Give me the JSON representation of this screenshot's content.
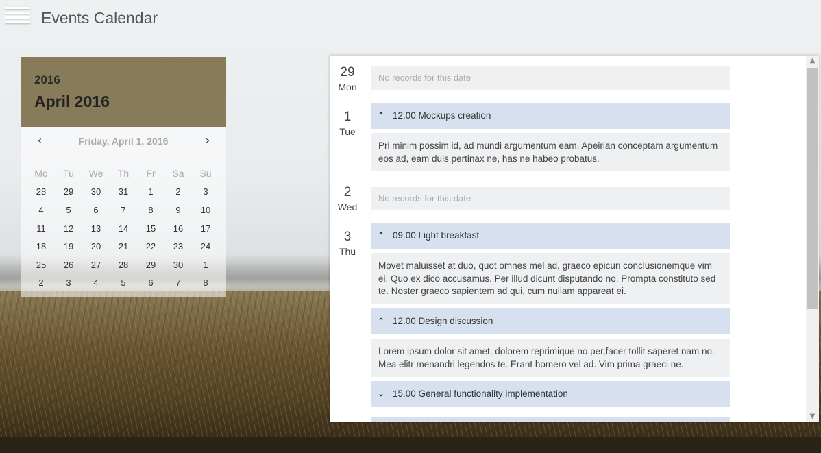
{
  "header": {
    "title": "Events Calendar",
    "menu_icon": "hamburger-menu-icon"
  },
  "calendar": {
    "year": "2016",
    "month_title": "April 2016",
    "selected_label": "Friday, April 1, 2016",
    "prev_icon": "‹",
    "next_icon": "›",
    "weekdays": [
      "Mo",
      "Tu",
      "We",
      "Th",
      "Fr",
      "Sa",
      "Su"
    ],
    "weeks": [
      [
        "28",
        "29",
        "30",
        "31",
        "1",
        "2",
        "3"
      ],
      [
        "4",
        "5",
        "6",
        "7",
        "8",
        "9",
        "10"
      ],
      [
        "11",
        "12",
        "13",
        "14",
        "15",
        "16",
        "17"
      ],
      [
        "18",
        "19",
        "20",
        "21",
        "22",
        "23",
        "24"
      ],
      [
        "25",
        "26",
        "27",
        "28",
        "29",
        "30",
        "1"
      ],
      [
        "2",
        "3",
        "4",
        "5",
        "6",
        "7",
        "8"
      ]
    ]
  },
  "events": {
    "no_records_text": "No records for this date",
    "days": [
      {
        "num": "29",
        "name": "Mon"
      },
      {
        "num": "1",
        "name": "Tue"
      },
      {
        "num": "2",
        "name": "Wed"
      },
      {
        "num": "3",
        "name": "Thu"
      }
    ],
    "items": [
      {
        "title": "12.00 Mockups creation",
        "expanded": true,
        "chevron": "^",
        "desc": "Pri minim possim id, ad mundi argumentum eam. Apeirian conceptam argumentum eos ad, eam duis pertinax ne, has ne habeo probatus."
      },
      {
        "title": "09.00 Light breakfast",
        "expanded": true,
        "chevron": "^",
        "desc": "Movet maluisset at duo, quot omnes mel ad, graeco epicuri conclusionemque vim ei. Quo ex dico accusamus. Per illud dicunt disputando no. Prompta constituto sed te. Noster graeco sapientem ad qui, cum nullam appareat ei."
      },
      {
        "title": "12.00 Design discussion",
        "expanded": true,
        "chevron": "^",
        "desc": "Lorem ipsum dolor sit amet, dolorem reprimique no per,facer tollit saperet nam no. Mea elitr menandri legendos te. Erant homero vel ad. Vim prima graeci ne."
      },
      {
        "title": "15.00 General functionality implementation",
        "expanded": false,
        "chevron": "v"
      }
    ]
  },
  "colors": {
    "calendar_header": "#877b5a",
    "event_header": "#d6e0ef",
    "event_body": "#eef0f2"
  }
}
